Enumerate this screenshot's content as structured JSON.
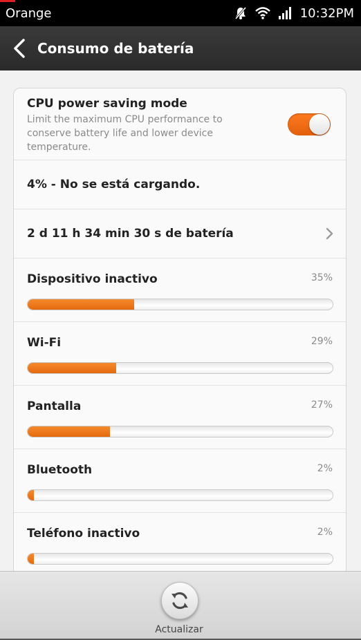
{
  "status_bar": {
    "carrier": "Orange",
    "time": "10:32PM",
    "icons": [
      "notifications-muted-icon",
      "wifi-icon",
      "signal-icon"
    ]
  },
  "title_bar": {
    "title": "Consumo de batería",
    "back_icon": "back-arrow-icon"
  },
  "cpu_saving": {
    "title": "CPU power saving mode",
    "description": "Limit the maximum CPU performance to conserve battery life and lower device temperature.",
    "enabled": true
  },
  "battery_status": "4% - No se está cargando.",
  "battery_time": "2 d 11 h 34 min 30 s de batería",
  "usage": [
    {
      "label": "Dispositivo inactivo",
      "percent_label": "35%",
      "fraction": 0.35
    },
    {
      "label": "Wi-Fi",
      "percent_label": "29%",
      "fraction": 0.29
    },
    {
      "label": "Pantalla",
      "percent_label": "27%",
      "fraction": 0.27
    },
    {
      "label": "Bluetooth",
      "percent_label": "2%",
      "fraction": 0.02
    },
    {
      "label": "Teléfono inactivo",
      "percent_label": "2%",
      "fraction": 0.02
    }
  ],
  "bottom": {
    "refresh_label": "Actualizar",
    "refresh_icon": "refresh-icon"
  },
  "colors": {
    "accent": "#e96c12",
    "title_bar": "#2f2f2f",
    "status_bar": "#000000"
  }
}
